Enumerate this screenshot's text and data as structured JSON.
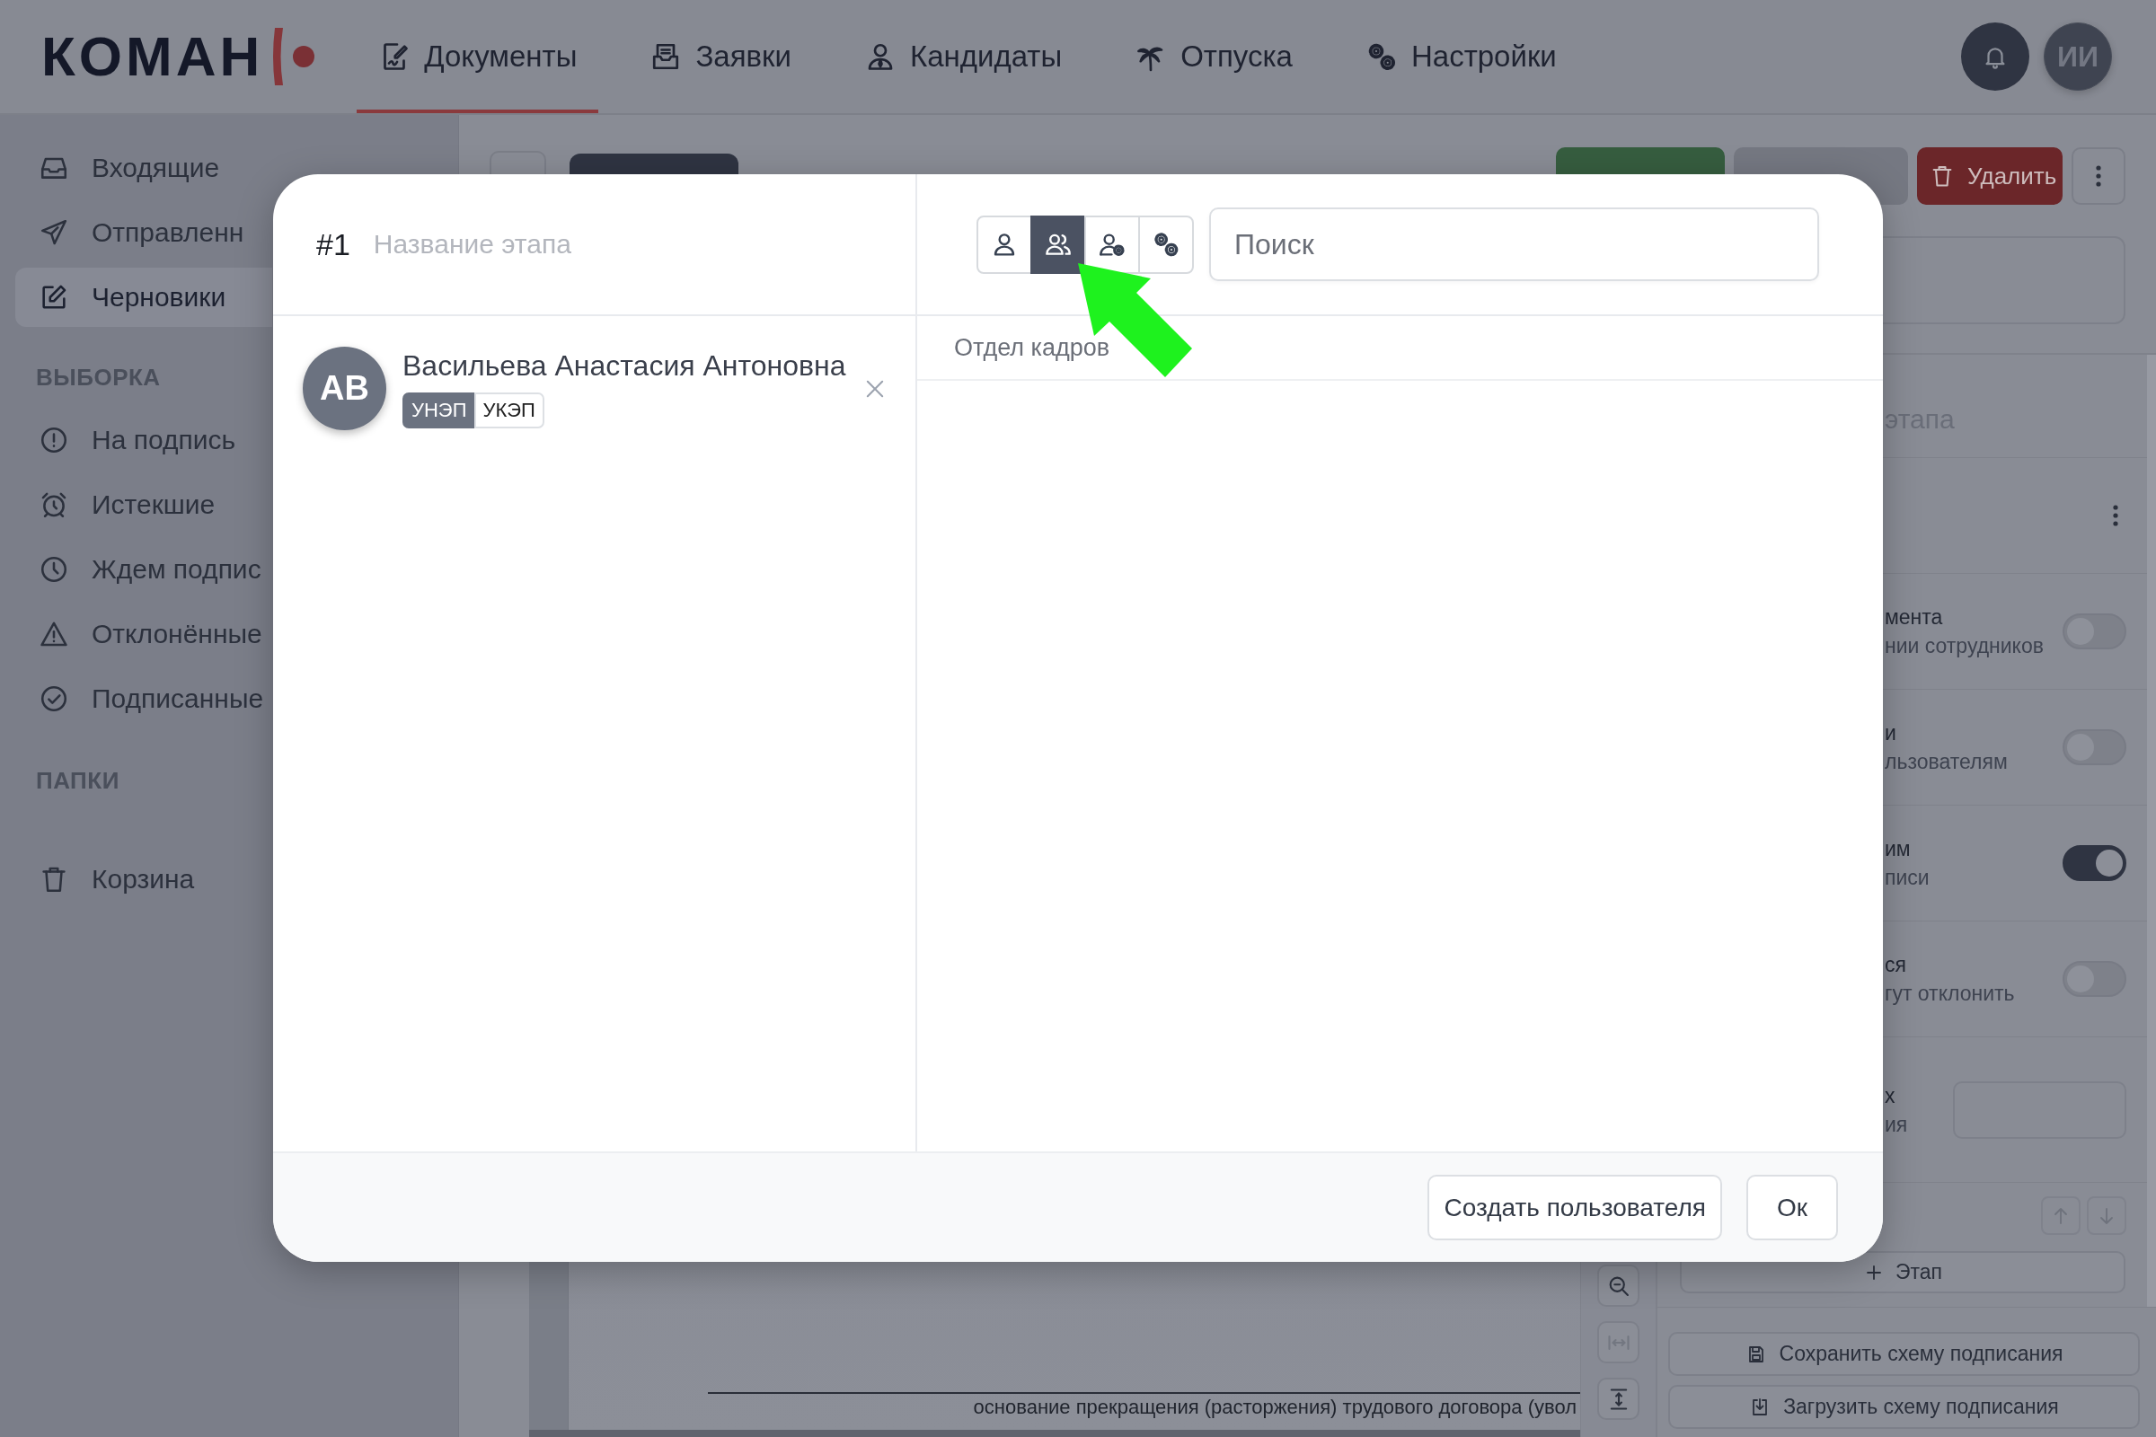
{
  "nav": {
    "logo": "КОМАН",
    "tabs": [
      {
        "label": "Документы",
        "selected": true
      },
      {
        "label": "Заявки",
        "selected": false
      },
      {
        "label": "Кандидаты",
        "selected": false
      },
      {
        "label": "Отпуска",
        "selected": false
      },
      {
        "label": "Настройки",
        "selected": false
      }
    ],
    "user_initials": "ИИ"
  },
  "sidebar": {
    "items": [
      {
        "label": "Входящие",
        "selected": false
      },
      {
        "label": "Отправленн",
        "selected": false
      },
      {
        "label": "Черновики",
        "selected": true
      }
    ],
    "sections": [
      {
        "title": "ВЫБОРКА",
        "items": [
          {
            "label": "На подпись",
            "selected": false
          },
          {
            "label": "Истекшие",
            "selected": false
          },
          {
            "label": "Ждем подпис",
            "selected": false
          },
          {
            "label": "Отклонённые",
            "selected": false
          },
          {
            "label": "Подписанные",
            "selected": false
          }
        ]
      },
      {
        "title": "ПАПКИ",
        "items": [
          {
            "label": "Корзина",
            "selected": false
          }
        ]
      }
    ]
  },
  "toolbar": {
    "buttons": [
      {
        "kind": "save"
      },
      {
        "kind": "send",
        "disabled": true
      },
      {
        "kind": "delete",
        "label": "Удалить"
      },
      {
        "kind": "more"
      }
    ]
  },
  "viewer": {
    "document_text": "основание прекращения (расторжения) трудового договора (увол"
  },
  "signing_panel": {
    "stage_name": "этапа",
    "settings": [
      {
        "kind": "toggle",
        "lines": [
          "мента",
          "нии сотрудников"
        ],
        "on": false
      },
      {
        "kind": "toggle",
        "lines": [
          "и",
          "льзователям"
        ],
        "on": false
      },
      {
        "kind": "toggle",
        "lines": [
          "им",
          "писи"
        ],
        "on": true
      },
      {
        "kind": "toggle",
        "lines": [
          "ся",
          "гут отклонить"
        ],
        "on": false
      },
      {
        "kind": "input",
        "lines": [
          "х",
          "ия"
        ]
      }
    ],
    "add_stage_button": "Этап",
    "save_scheme_button": "Сохранить схему подписания",
    "load_scheme_button": "Загрузить схему подписания"
  },
  "modal": {
    "stage": {
      "number": "#1",
      "name_placeholder": "Название этапа"
    },
    "signers": [
      {
        "initials": "АВ",
        "name": "Васильева Анастасия Антоновна",
        "signature_types": [
          {
            "label": "УНЭП",
            "selected": true
          },
          {
            "label": "УКЭП",
            "selected": false
          }
        ]
      }
    ],
    "picker": {
      "modes": [
        {
          "kind": "user",
          "selected": false
        },
        {
          "kind": "group",
          "selected": true
        },
        {
          "kind": "user-settings",
          "selected": false
        },
        {
          "kind": "settings",
          "selected": false
        }
      ],
      "search_placeholder": "Поиск",
      "results": [
        "Отдел кадров"
      ]
    },
    "buttons": [
      "Создать пользователя",
      "Ок"
    ]
  }
}
